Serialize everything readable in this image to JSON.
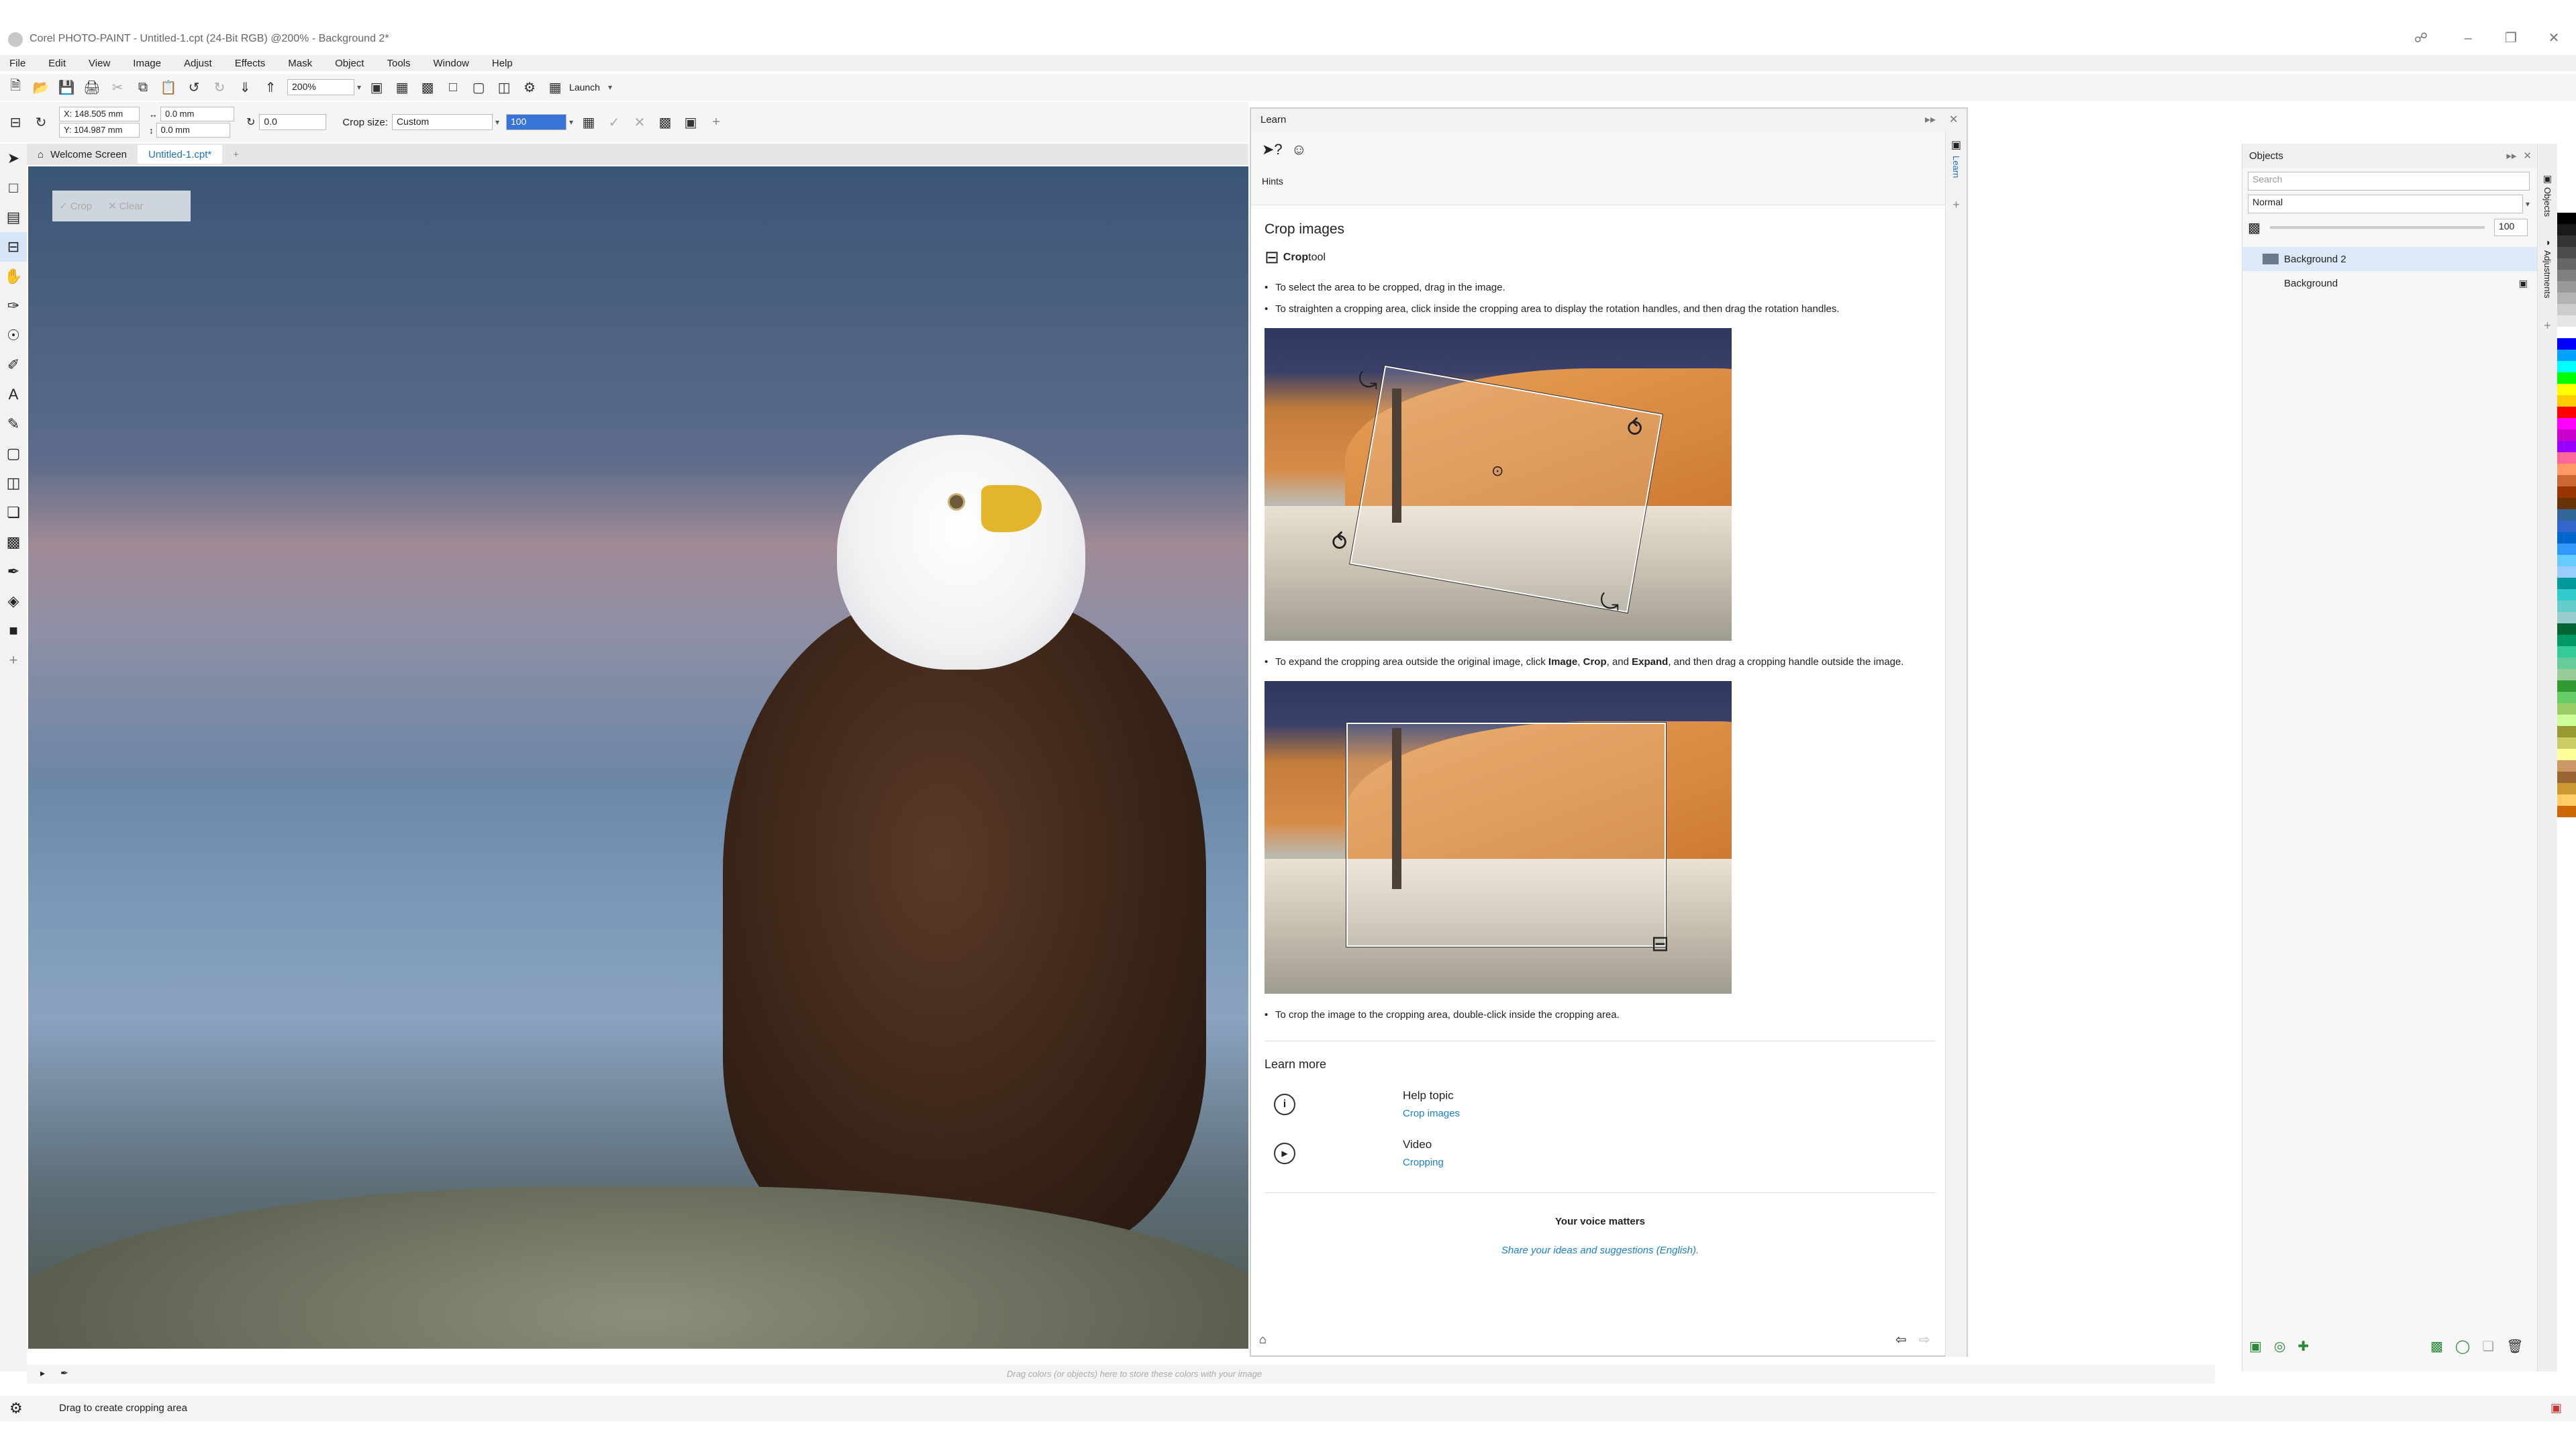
{
  "window": {
    "title": "Corel PHOTO-PAINT - Untitled-1.cpt (24-Bit RGB) @200% - Background 2*",
    "minimize": "–",
    "restore": "❐",
    "close": "✕"
  },
  "menu": [
    "File",
    "Edit",
    "View",
    "Image",
    "Adjust",
    "Effects",
    "Mask",
    "Object",
    "Tools",
    "Window",
    "Help"
  ],
  "toolbar": {
    "zoom": "200%",
    "launch": "Launch"
  },
  "propbar": {
    "x": "X: 148.505 mm",
    "y": "Y: 104.987 mm",
    "w": "0.0 mm",
    "h": "0.0 mm",
    "angle": "0.0",
    "crop_size_label": "Crop size:",
    "crop_size": "Custom",
    "resolution": "100"
  },
  "tabs": [
    {
      "label": "Welcome Screen"
    },
    {
      "label": "Untitled-1.cpt*"
    }
  ],
  "canvas_crop": {
    "crop": "Crop",
    "clear": "Clear"
  },
  "learn": {
    "title": "Learn",
    "hints_label": "Hints",
    "side_tab": "Learn",
    "heading": "Crop images",
    "tool_bold": "Crop",
    "tool_rest": " tool",
    "b1": "To select the area to be cropped, drag in the image.",
    "b2": "To straighten a cropping area, click inside the cropping area to display the rotation handles, and then drag the rotation handles.",
    "b3_pre": "To expand the cropping area outside the original image, click ",
    "b3_image": "Image",
    "b3_comma": ", ",
    "b3_crop": "Crop",
    "b3_and": ", and ",
    "b3_expand": "Expand",
    "b3_post": ", and then drag a cropping handle outside the image.",
    "b4": "To crop the image to the cropping area, double-click inside the cropping area.",
    "learn_more": "Learn more",
    "help_topic": "Help topic",
    "help_link": "Crop images",
    "video": "Video",
    "video_link": "Cropping",
    "voice": "Your voice matters",
    "voice_link": "Share your ideas and suggestions (English)."
  },
  "objects": {
    "title": "Objects",
    "search_placeholder": "Search",
    "blend_mode": "Normal",
    "opacity": "100",
    "layers": [
      "Background 2",
      "Background"
    ],
    "side_tab_objects": "Objects",
    "side_tab_adjustments": "Adjustments"
  },
  "hintbar": "Drag colors (or objects) here to store these colors with your image",
  "status": "Drag to create cropping area",
  "palette": [
    "#ffffff",
    "#000000",
    "#1a1a1a",
    "#333333",
    "#4d4d4d",
    "#666666",
    "#808080",
    "#999999",
    "#b3b3b3",
    "#cccccc",
    "#e6e6e6",
    "#ffffff",
    "#0000ff",
    "#00a0ff",
    "#00ffff",
    "#00ff00",
    "#ffff00",
    "#ffcc00",
    "#ff0000",
    "#ff00ff",
    "#cc00cc",
    "#9900ff",
    "#ff6699",
    "#ff9966",
    "#cc6633",
    "#993300",
    "#663300",
    "#336699",
    "#3366cc",
    "#0066cc",
    "#3399ff",
    "#66ccff",
    "#99ccff",
    "#009999",
    "#33cccc",
    "#66cccc",
    "#99cccc",
    "#006633",
    "#009966",
    "#33cc99",
    "#66cc99",
    "#99cc99",
    "#339933",
    "#66cc66",
    "#99cc66",
    "#ccff99",
    "#999933",
    "#cccc66",
    "#ffff99",
    "#cc9966",
    "#996633",
    "#cc9933",
    "#ffcc66",
    "#cc6600"
  ]
}
